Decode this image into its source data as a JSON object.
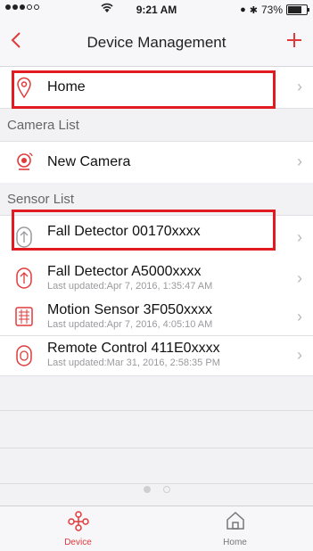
{
  "status_bar": {
    "time": "9:21 AM",
    "battery": "73%",
    "battery_level": 0.73
  },
  "nav": {
    "back_icon": "chevron-left",
    "title": "Device Management",
    "add_icon": "plus"
  },
  "home_row": {
    "title": "Home"
  },
  "camera_section": {
    "header": "Camera List",
    "items": [
      {
        "title": "New Camera"
      }
    ]
  },
  "sensor_section": {
    "header": "Sensor List",
    "items": [
      {
        "title": "Fall Detector 00170xxxx",
        "subtitle": ""
      },
      {
        "title": "Fall Detector A5000xxxx",
        "subtitle": "Last updated:Apr 7, 2016, 1:35:47 AM"
      },
      {
        "title": "Motion Sensor 3F050xxxx",
        "subtitle": "Last updated:Apr 7, 2016, 4:05:10 AM"
      },
      {
        "title": "Remote Control 411E0xxxx",
        "subtitle": "Last updated:Mar 31, 2016, 2:58:35 PM"
      }
    ]
  },
  "tabs": [
    {
      "label": "Device",
      "active": true
    },
    {
      "label": "Home",
      "active": false
    }
  ],
  "colors": {
    "accent": "#e03a3a",
    "highlight_border": "#e21b23"
  }
}
